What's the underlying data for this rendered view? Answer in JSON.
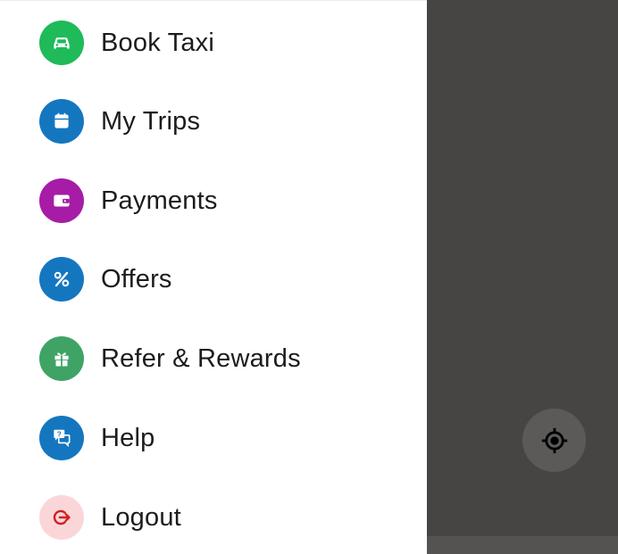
{
  "menu": {
    "items": [
      {
        "label": "Book Taxi",
        "icon": "car-icon",
        "color": "#1fba5a"
      },
      {
        "label": "My Trips",
        "icon": "calendar-icon",
        "color": "#1576c0"
      },
      {
        "label": "Payments",
        "icon": "wallet-icon",
        "color": "#a61ca6"
      },
      {
        "label": "Offers",
        "icon": "percent-icon",
        "color": "#1576c0"
      },
      {
        "label": "Refer & Rewards",
        "icon": "gift-icon",
        "color": "#3fa366"
      },
      {
        "label": "Help",
        "icon": "chat-question-icon",
        "color": "#1576c0"
      },
      {
        "label": "Logout",
        "icon": "logout-icon",
        "color": "#fbd6d8",
        "icon_color": "#d11f1f"
      }
    ]
  },
  "map_overlay": {
    "color": "#464544",
    "locate_button_icon": "crosshair-icon"
  }
}
